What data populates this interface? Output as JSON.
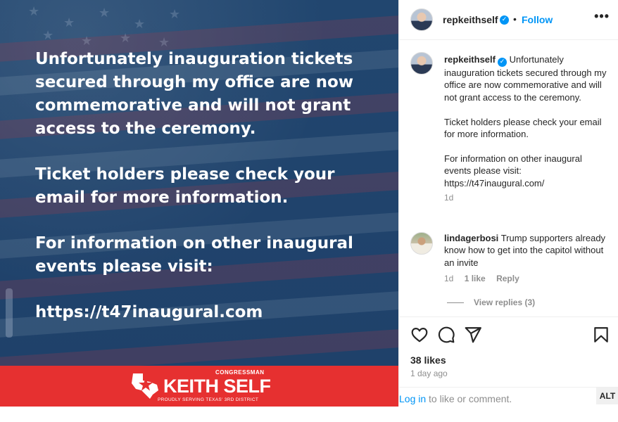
{
  "post_image": {
    "paragraphs": [
      "Unfortunately inauguration tickets secured through my office are now commemorative and will not grant access to the ceremony.",
      "Ticket holders please check your email for more information.",
      "For information on other inaugural events please visit:",
      "https://t47inaugural.com"
    ],
    "banner": {
      "title_small": "CONGRESSMAN",
      "name": "KEITH SELF",
      "subtitle": "PROUDLY SERVING TEXAS' 3RD DISTRICT",
      "color": "#e63030"
    },
    "background_color": "#1c3f6b"
  },
  "header": {
    "username": "repkeithself",
    "verified_icon": "verified-badge-icon",
    "separator": "•",
    "follow_label": "Follow",
    "more_label": "•••"
  },
  "caption": {
    "username": "repkeithself",
    "paragraphs": [
      "Unfortunately inauguration tickets secured through my office are now commemorative and will not grant access to the ceremony.",
      "Ticket holders please check your email for more information.",
      "For information on other inaugural events please visit: https://t47inaugural.com/"
    ],
    "time": "1d"
  },
  "comment": {
    "username": "lindagerbosi",
    "text": "Trump supporters already know how to get into the capitol without an invite",
    "time": "1d",
    "likes": "1 like",
    "reply_label": "Reply",
    "view_replies": "View replies (3)"
  },
  "actions": {
    "icons": [
      "heart-icon",
      "comment-icon",
      "share-icon",
      "bookmark-icon"
    ],
    "likes": "38 likes",
    "time_ago": "1 day ago"
  },
  "login": {
    "link": "Log in",
    "text": " to like or comment.",
    "alt_badge": "ALT"
  },
  "colors": {
    "accent": "#0095f6",
    "muted": "#8e8e8e",
    "text": "#262626"
  }
}
